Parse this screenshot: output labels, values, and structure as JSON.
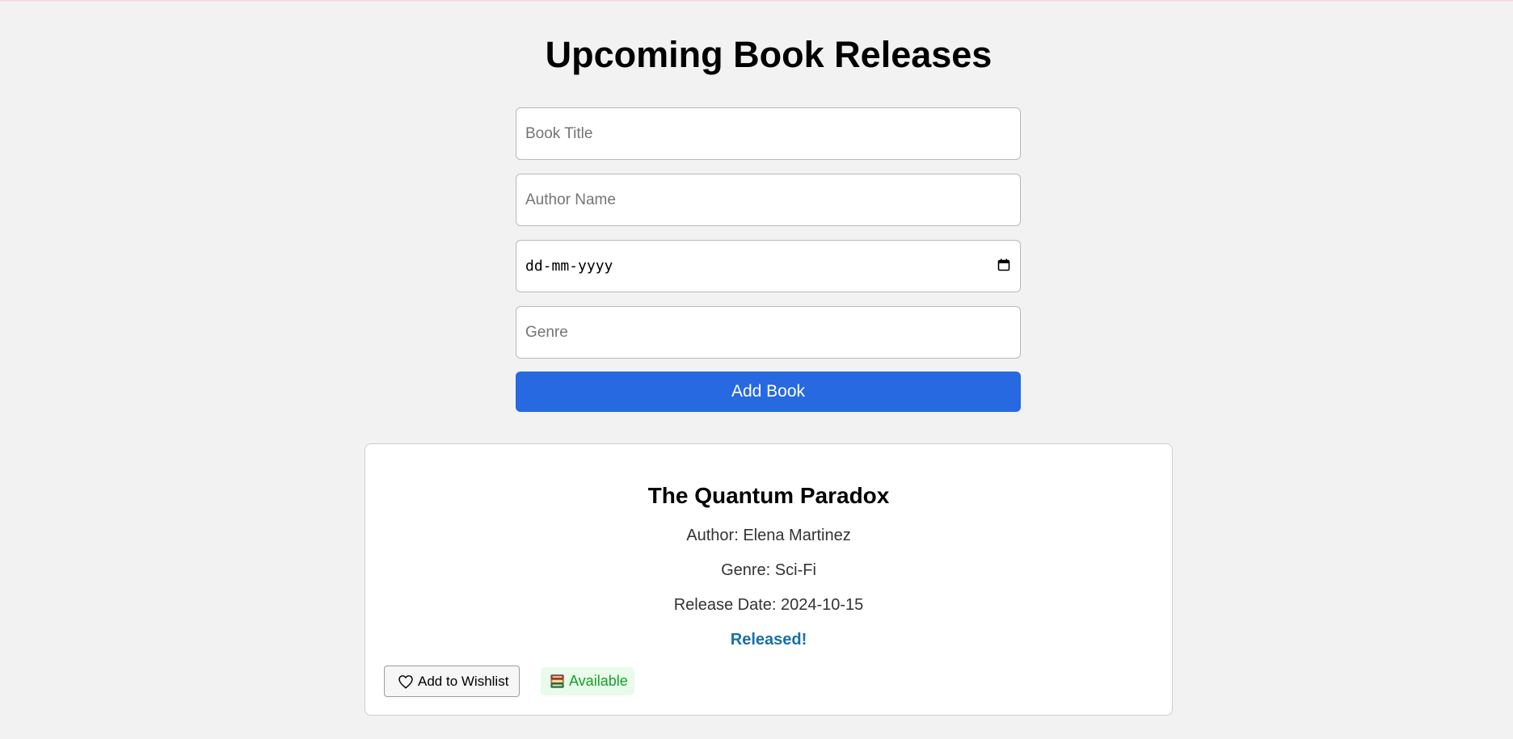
{
  "page": {
    "title": "Upcoming Book Releases"
  },
  "form": {
    "title_placeholder": "Book Title",
    "author_placeholder": "Author Name",
    "date_placeholder": "dd-mm-yyyy",
    "genre_placeholder": "Genre",
    "submit_label": "Add Book"
  },
  "books": [
    {
      "title": "The Quantum Paradox",
      "author": "Author: Elena Martinez",
      "genre": "Genre: Sci-Fi",
      "release_date": "Release Date: 2024-10-15",
      "status": "Released!",
      "wishlist_label": "Add to Wishlist",
      "availability": "Available"
    }
  ],
  "icons": {
    "calendar": "calendar-icon",
    "heart": "heart-icon",
    "books": "books-icon"
  },
  "colors": {
    "accent": "#2669e1",
    "released": "#1670ad",
    "available_text": "#16a02b",
    "available_bg": "#e9fbea"
  }
}
